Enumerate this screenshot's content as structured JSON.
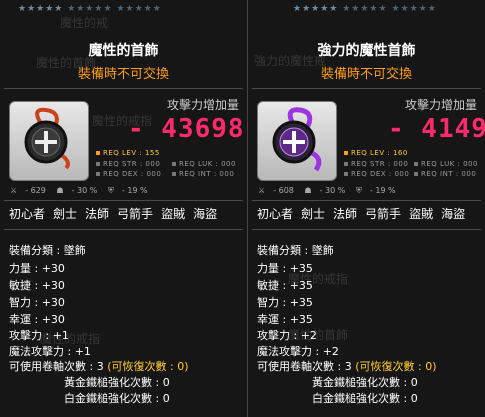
{
  "left": {
    "stars_total": 15,
    "item_name": "魔性的首飾",
    "untradeable": "裝備時不可交換",
    "attack_increase_label": "攻擊力增加量",
    "attack_increase_value": "- 43698",
    "req_lev_label": "REQ LEV :",
    "req_lev_value": "155",
    "req_str": "REQ STR : 000",
    "req_luk": "REQ LUK : 000",
    "req_dex": "REQ DEX : 000",
    "req_int": "REQ INT : 000",
    "mini_stats": [
      "- 629",
      "- 30 %",
      "- 19 %"
    ],
    "jobs": [
      "初心者",
      "劍士",
      "法師",
      "弓箭手",
      "盜賊",
      "海盜"
    ],
    "stats": [
      "裝備分類 : 墜飾",
      "力量 : +30",
      "敏捷 : +30",
      "智力 : +30",
      "幸運 : +30",
      "攻擊力 : +1",
      "魔法攻擊力 : +1"
    ],
    "scroll_label": "可使用卷軸次數 : 3",
    "scroll_restore": "(可恢復次數 : 0)",
    "gold_hammer": "黃金鐵槌強化次數 : 0",
    "white_hammer": "白金鐵槌強化次數 : 0",
    "ghost_texts": [
      "魔性的戒",
      "魔性的戒指",
      "魔性的戒指",
      "魔性的首飾"
    ]
  },
  "right": {
    "stars_total": 15,
    "item_name": "強力的魔性首飾",
    "untradeable": "裝備時不可交換",
    "attack_increase_label": "攻擊力增加量",
    "attack_increase_value": "- 4149",
    "req_lev_label": "REQ LEV :",
    "req_lev_value": "160",
    "req_str": "REQ STR : 000",
    "req_luk": "REQ LUK : 000",
    "req_dex": "REQ DEX : 000",
    "req_int": "REQ INT : 000",
    "mini_stats": [
      "- 608",
      "- 30 %",
      "- 19 %"
    ],
    "jobs": [
      "初心者",
      "劍士",
      "法師",
      "弓箭手",
      "盜賊",
      "海盜"
    ],
    "stats": [
      "裝備分類 : 墜飾",
      "力量 : +35",
      "敏捷 : +35",
      "智力 : +35",
      "幸運 : +35",
      "攻擊力 : +2",
      "魔法攻擊力 : +2"
    ],
    "scroll_label": "可使用卷軸次數 : 3",
    "scroll_restore": "(可恢復次數 : 0)",
    "gold_hammer": "黃金鐵槌強化次數 : 0",
    "white_hammer": "白金鐵槌強化次數 : 0",
    "ghost_texts": [
      "強力的魔性戒",
      "魔性的戒指",
      "魔性的首飾",
      "魔性的首飾"
    ]
  },
  "colors": {
    "attack_value": "#ff2a6b",
    "untradeable": "#ff9d1a",
    "gold_text": "#ffcc33",
    "left_icon_accent": "#c8421c",
    "right_icon_accent": "#9b35e0"
  },
  "icons": {
    "left": "dark-cross-pendant-icon",
    "right": "purple-cross-pendant-icon"
  }
}
